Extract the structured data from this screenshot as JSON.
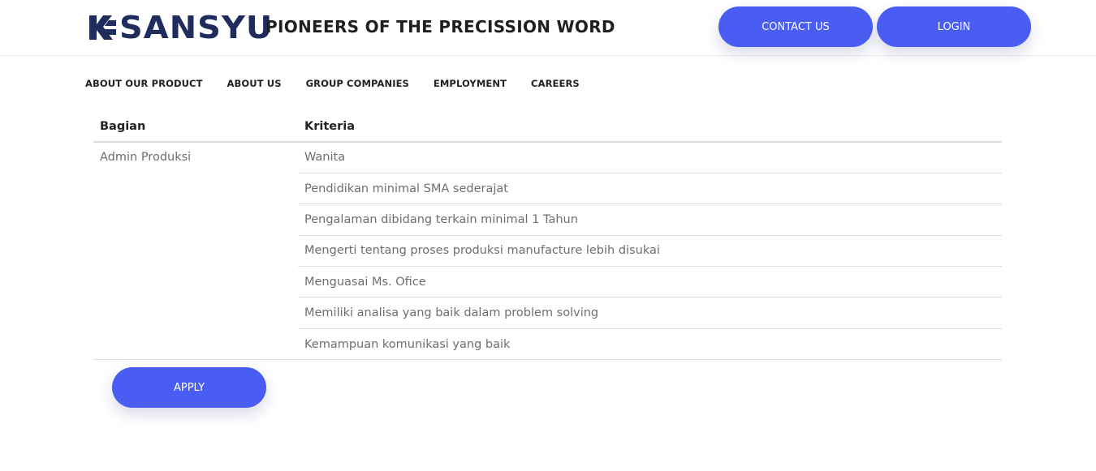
{
  "header": {
    "logo_text": "SANSYU",
    "tagline": "PIONEERS OF THE PRECISSION WORD",
    "contact_label": "CONTACT US",
    "login_label": "LOGIN"
  },
  "nav": {
    "items": [
      "ABOUT OUR PRODUCT",
      "ABOUT US",
      "GROUP COMPANIES",
      "EMPLOYMENT",
      "CAREERS"
    ]
  },
  "table": {
    "headers": [
      "Bagian",
      "Kriteria"
    ],
    "part": "Admin Produksi",
    "criteria": [
      "Wanita",
      "Pendidikan minimal SMA sederajat",
      "Pengalaman dibidang terkain minimal 1 Tahun",
      "Mengerti tentang proses produksi manufacture lebih disukai",
      "Menguasai Ms. Ofice",
      "Memiliki analisa yang baik dalam problem solving",
      "Kemampuan komunikasi yang baik"
    ]
  },
  "apply_label": "APPLY",
  "colors": {
    "accent": "#4a5df2",
    "brand": "#1f2c5c"
  }
}
